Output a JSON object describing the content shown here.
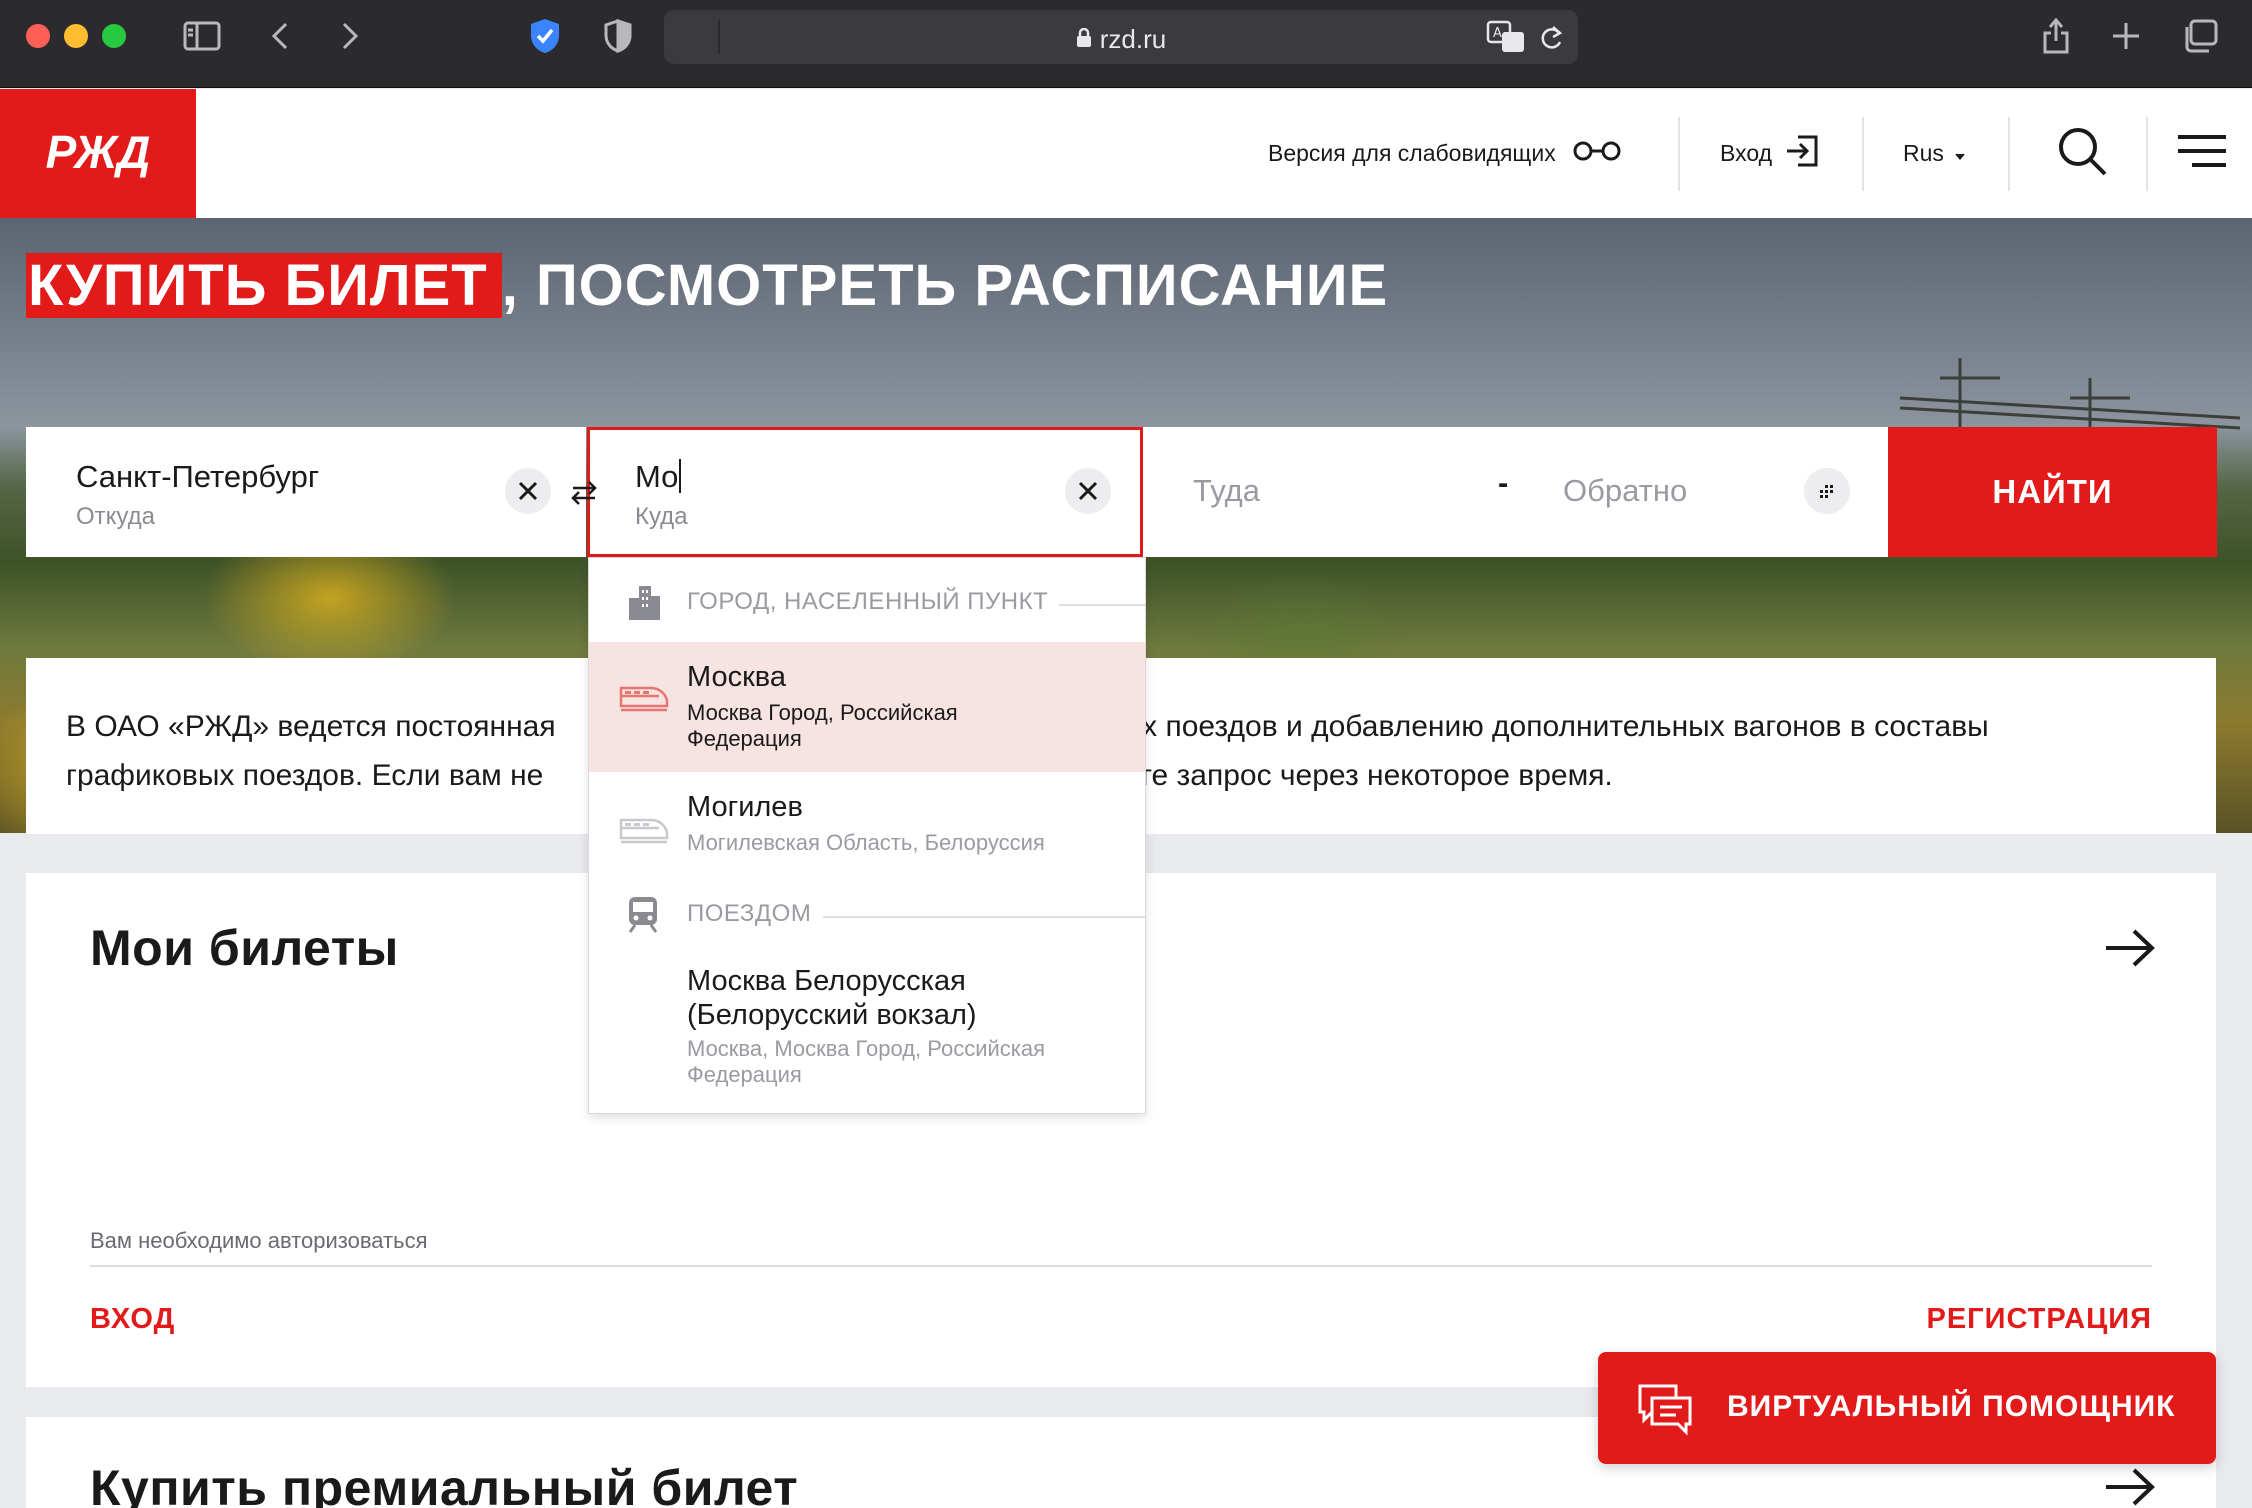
{
  "browser": {
    "url": "rzd.ru"
  },
  "header": {
    "logo_text": "РЖД",
    "accessibility_label": "Версия для слабовидящих",
    "login_label": "Вход",
    "language": "Rus"
  },
  "hero": {
    "title_highlight": "КУПИТЬ БИЛЕТ",
    "title_rest": ", ПОСМОТРЕТЬ РАСПИСАНИЕ"
  },
  "search": {
    "from_value": "Санкт-Петербург",
    "from_label": "Откуда",
    "to_value": "Мо",
    "to_label": "Куда",
    "depart_placeholder": "Туда",
    "date_separator": "-",
    "return_placeholder": "Обратно",
    "find_label": "НАЙТИ"
  },
  "dropdown": {
    "group_city": "ГОРОД, НАСЕЛЕННЫЙ ПУНКТ",
    "group_train": "ПОЕЗДОМ",
    "items": [
      {
        "title": "Москва",
        "subtitle": "Москва Город, Российская Федерация"
      },
      {
        "title": "Могилев",
        "subtitle": "Могилевская Область, Белоруссия"
      },
      {
        "title": "Москва Белорусская (Белорусский вокзал)",
        "subtitle": "Москва, Москва Город, Российская Федерация"
      }
    ]
  },
  "notice": {
    "line1_start": "В ОАО «РЖД» ведется постоянная",
    "line1_end": "ых поездов и добавлению дополнительных вагонов в составы",
    "line2_start": "графиковых поездов. Если вам не",
    "line2_end": "йте запрос через некоторое время."
  },
  "tickets_card": {
    "title": "Мои билеты",
    "hint": "Вам необходимо авторизоваться",
    "login_link": "ВХОД",
    "register_link": "РЕГИСТРАЦИЯ"
  },
  "premium_card": {
    "title": "Купить премиальный билет"
  },
  "assistant": {
    "label": "ВИРТУАЛЬНЫЙ ПОМОЩНИК"
  },
  "colors": {
    "brand_red": "#e21a1a",
    "highlight_row": "#f8e3e3"
  }
}
